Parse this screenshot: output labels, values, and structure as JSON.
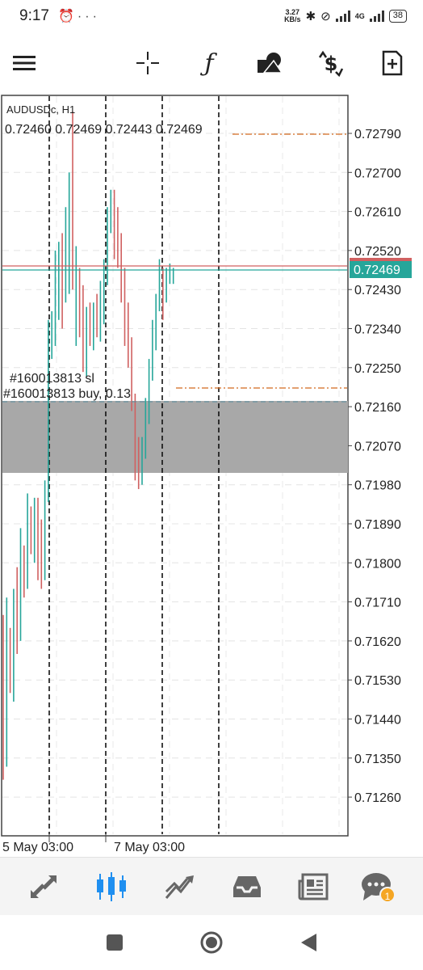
{
  "status_bar": {
    "time": "9:17",
    "left_icons": [
      "alarm-icon",
      "more-dots-icon"
    ],
    "network_speed_value": "3.27",
    "network_speed_unit": "KB/s",
    "network_type": "4G",
    "battery": "38"
  },
  "toolbar": {
    "items": [
      "menu-icon",
      "crosshair-icon",
      "function-icon",
      "objects-icon",
      "trade-icon",
      "new-order-icon"
    ]
  },
  "chart": {
    "symbol_label": "AUDUSDc, H1",
    "ohlc": "0.72460 0.72469 0.72443 0.72469",
    "current_price": "0.72469",
    "order_sl_label": "#160013813 sl",
    "order_buy_label": "#160013813 buy, 0.13",
    "price_labels": [
      "0.72790",
      "0.72700",
      "0.72610",
      "0.72520",
      "0.72430",
      "0.72340",
      "0.72250",
      "0.72160",
      "0.72070",
      "0.71980",
      "0.71890",
      "0.71800",
      "0.71710",
      "0.71620",
      "0.71530",
      "0.71440",
      "0.71350",
      "0.71260"
    ],
    "time_labels": [
      "5 May 03:00",
      "7 May 03:00"
    ],
    "colors": {
      "bull": "#26a69a",
      "bear": "#d06060",
      "bid_line": "#26a69a",
      "ask_line": "#d06060",
      "order_line": "#d2691e",
      "zone": "#a8a8a8"
    }
  },
  "bottom_nav": {
    "items": [
      "quotes-icon",
      "chart-icon",
      "trade-icon",
      "history-icon",
      "news-icon",
      "messages-icon"
    ],
    "active": "chart-icon",
    "messages_badge": "1"
  },
  "system_nav": {
    "items": [
      "recent-apps-button",
      "home-button",
      "back-button"
    ]
  }
}
